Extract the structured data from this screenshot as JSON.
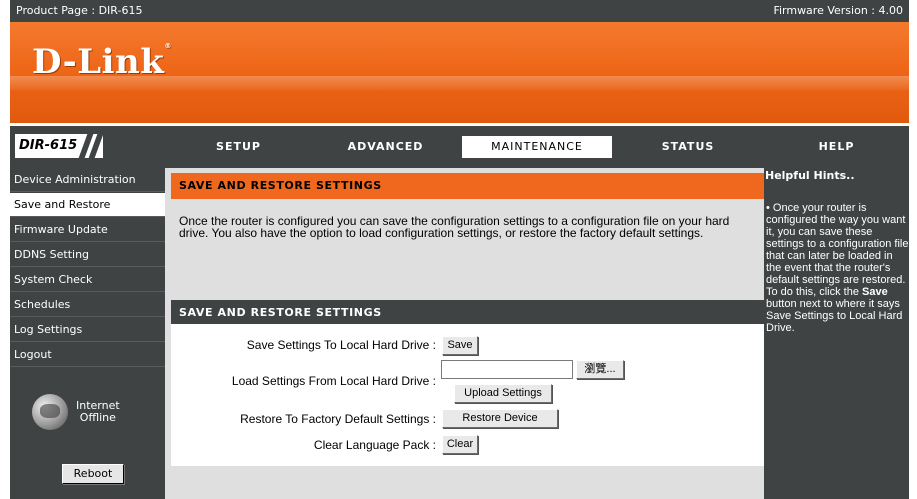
{
  "header": {
    "product": "Product Page : DIR-615",
    "firmware": "Firmware Version : 4.00"
  },
  "banner": {
    "logo": "D-Link",
    "logo_mark": "®"
  },
  "model": "DIR-615",
  "tabs": [
    {
      "label": "SETUP",
      "active": false
    },
    {
      "label": "ADVANCED",
      "active": false
    },
    {
      "label": "MAINTENANCE",
      "active": true
    },
    {
      "label": "STATUS",
      "active": false
    },
    {
      "label": "HELP",
      "active": false
    }
  ],
  "sidebar": {
    "items": [
      {
        "label": "Device Administration"
      },
      {
        "label": "Save and Restore"
      },
      {
        "label": "Firmware Update"
      },
      {
        "label": "DDNS Setting"
      },
      {
        "label": "System Check"
      },
      {
        "label": "Schedules"
      },
      {
        "label": "Log Settings"
      },
      {
        "label": "Logout"
      }
    ],
    "internet_line1": "Internet",
    "internet_line2": "Offline",
    "reboot_label": "Reboot"
  },
  "intro": {
    "title": "SAVE AND RESTORE SETTINGS",
    "description": "Once the router is configured you can save the configuration settings to a configuration file on your hard drive. You also have the option to load configuration settings, or restore the factory default settings."
  },
  "settings": {
    "title": "SAVE AND RESTORE SETTINGS",
    "save_label": "Save Settings To Local Hard Drive :",
    "save_button": "Save",
    "load_label": "Load Settings From Local Hard Drive :",
    "browse_button": "瀏覽...",
    "file_value": "",
    "upload_button": "Upload Settings",
    "restore_label": "Restore To Factory Default Settings :",
    "restore_button": "Restore Device",
    "clear_label": "Clear Language Pack :",
    "clear_button": "Clear"
  },
  "help": {
    "title": "Helpful Hints..",
    "bullet": "•",
    "text_before": "Once your router is configured the way you want it, you can save these settings to a configuration file that can later be loaded in the event that the router's default settings are restored. To do this, click the",
    "text_bold": "Save",
    "text_after": "button next to where it says Save Settings to Local Hard Drive."
  }
}
